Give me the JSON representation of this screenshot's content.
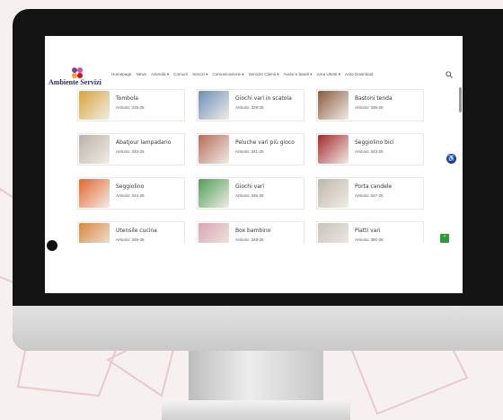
{
  "site": {
    "logo_text": "Ambiente Servizi"
  },
  "nav": {
    "items": [
      "Homepage",
      "News",
      "Azienda ▾",
      "Comuni",
      "Servizi ▾",
      "Comunicazione ▾",
      "Servizio Clienti ▾",
      "Avvisi e bandi ▾",
      "Area Utenti ▾",
      "Area Download"
    ]
  },
  "products": [
    {
      "title": "Tombola",
      "code": "Articolo: 315-25",
      "color": "#d7a43a"
    },
    {
      "title": "Giochi vari in scatola",
      "code": "Articolo: 329-25",
      "color": "#6b8fb8"
    },
    {
      "title": "Bastoni tenda",
      "code": "Articolo: 335-25",
      "color": "#8a5a3e"
    },
    {
      "title": "Abatjour lampadario",
      "code": "Articolo: 340-25",
      "color": "#b9b2a8"
    },
    {
      "title": "Peluche vari più gioco",
      "code": "Articolo: 341-25",
      "color": "#b66c5a"
    },
    {
      "title": "Seggiolino bici",
      "code": "Articolo: 343-25",
      "color": "#a0282c"
    },
    {
      "title": "Seggiolino",
      "code": "Articolo: 344-25",
      "color": "#e2672f"
    },
    {
      "title": "Giochi vari",
      "code": "Articolo: 345-25",
      "color": "#4f9f56"
    },
    {
      "title": "Porta candele",
      "code": "Articolo: 347-25",
      "color": "#bdb6ad"
    },
    {
      "title": "Utensile cucina",
      "code": "Articolo: 348-25",
      "color": "#d98740"
    },
    {
      "title": "Box bambino",
      "code": "Articolo: 349-25",
      "color": "#d9a5b0"
    },
    {
      "title": "Piatti vari",
      "code": "Articolo: 350-25",
      "color": "#c7c2ba"
    }
  ],
  "colors": {
    "accent_green": "#2e9b3b",
    "access_blue": "#2a3b6a",
    "bg_pattern_red": "#e7c4c4"
  }
}
